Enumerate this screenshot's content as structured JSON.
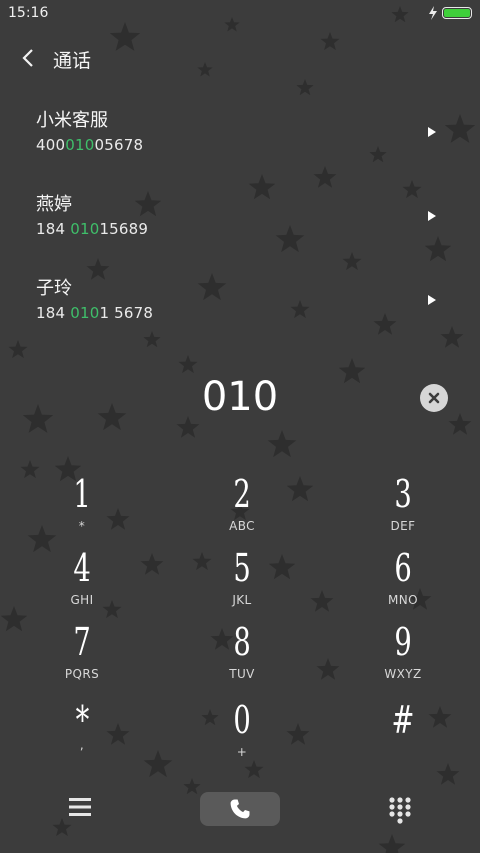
{
  "status_bar": {
    "time": "15:16"
  },
  "header": {
    "title": "通话"
  },
  "contacts": [
    {
      "name": "小米客服",
      "number_parts": [
        "400",
        "010",
        "05678"
      ]
    },
    {
      "name": "燕婷",
      "number_parts": [
        "184 ",
        "010",
        "15689"
      ]
    },
    {
      "name": "子玲",
      "number_parts": [
        "184 ",
        "010",
        "1 5678"
      ]
    }
  ],
  "dial_display": "010",
  "keypad": [
    {
      "digit": "1",
      "letters": "*"
    },
    {
      "digit": "2",
      "letters": "ABC"
    },
    {
      "digit": "3",
      "letters": "DEF"
    },
    {
      "digit": "4",
      "letters": "GHI"
    },
    {
      "digit": "5",
      "letters": "JKL"
    },
    {
      "digit": "6",
      "letters": "MNO"
    },
    {
      "digit": "7",
      "letters": "PQRS"
    },
    {
      "digit": "8",
      "letters": "TUV"
    },
    {
      "digit": "9",
      "letters": "WXYZ"
    },
    {
      "digit": "*",
      "letters": ","
    },
    {
      "digit": "0",
      "letters": "+"
    },
    {
      "digit": "#",
      "letters": ""
    }
  ],
  "colors": {
    "background": "#3c3c3c",
    "highlight": "#3fbf6a",
    "battery": "#3fcf3a"
  },
  "icons": [
    "back-chevron-icon",
    "charging-icon",
    "battery-icon",
    "play-arrow-icon",
    "delete-icon",
    "menu-icon",
    "phone-icon",
    "dialpad-icon"
  ]
}
